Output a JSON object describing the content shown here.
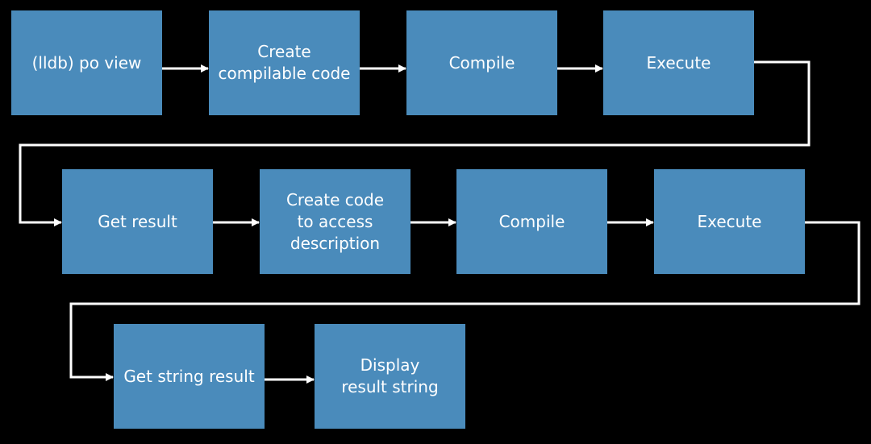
{
  "colors": {
    "box": "#4a8bbb",
    "background": "#000000",
    "connector": "#ffffff",
    "text": "#ffffff"
  },
  "nodes": [
    {
      "id": "n1",
      "label": "(lldb) po view"
    },
    {
      "id": "n2",
      "label": "Create compilable code"
    },
    {
      "id": "n3",
      "label": "Compile"
    },
    {
      "id": "n4",
      "label": "Execute"
    },
    {
      "id": "n5",
      "label": "Get result"
    },
    {
      "id": "n6",
      "label": "Create code to access description"
    },
    {
      "id": "n7",
      "label": "Compile"
    },
    {
      "id": "n8",
      "label": "Execute"
    },
    {
      "id": "n9",
      "label": "Get string result"
    },
    {
      "id": "n10",
      "label": "Display result string"
    }
  ],
  "edges": [
    [
      "n1",
      "n2"
    ],
    [
      "n2",
      "n3"
    ],
    [
      "n3",
      "n4"
    ],
    [
      "n4",
      "n5"
    ],
    [
      "n5",
      "n6"
    ],
    [
      "n6",
      "n7"
    ],
    [
      "n7",
      "n8"
    ],
    [
      "n8",
      "n9"
    ],
    [
      "n9",
      "n10"
    ]
  ]
}
